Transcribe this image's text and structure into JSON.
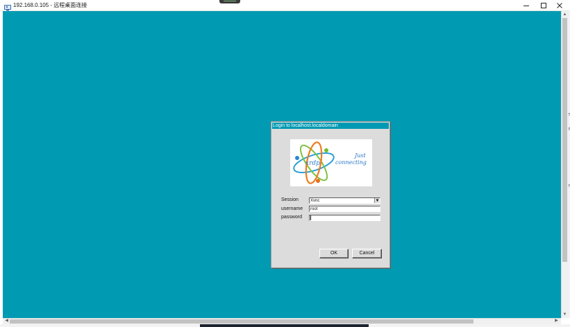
{
  "window": {
    "title": "192.168.0.105 - 远程桌面连接",
    "buttons": {
      "minimize": "minimize",
      "maximize": "maximize",
      "close": "close"
    }
  },
  "desktop": {
    "background_color": "#009bb2"
  },
  "right_edge_glyphs": [
    "e",
    "m",
    "e",
    "/"
  ],
  "login_dialog": {
    "title": "Login to localhost.localdomain",
    "logo": {
      "brand": "xrdp",
      "tagline_line1": "Just",
      "tagline_line2": "connecting"
    },
    "fields": {
      "session": {
        "label": "Session",
        "value": "Xvnc"
      },
      "username": {
        "label": "username",
        "value": "root"
      },
      "password": {
        "label": "password",
        "value": ""
      }
    },
    "buttons": {
      "ok": "OK",
      "cancel": "Cancel"
    }
  },
  "colors": {
    "accent": "#0099b3",
    "dialog_bg": "#dcdcdc"
  }
}
